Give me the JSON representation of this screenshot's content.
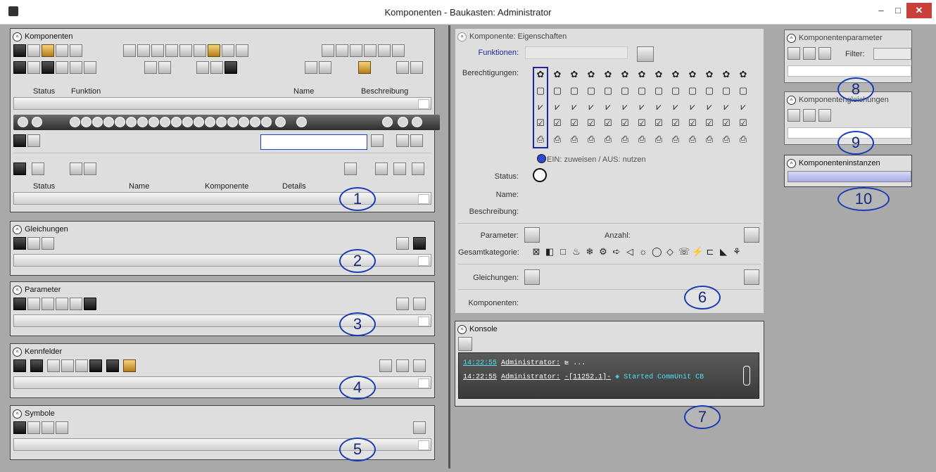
{
  "window": {
    "title": "Komponenten - Baukasten: Administrator",
    "minimize_label": "–",
    "maximize_label": "□",
    "close_label": "✕"
  },
  "left": {
    "komponenten": {
      "title": "Komponenten",
      "columns1": {
        "status": "Status",
        "funktion": "Funktion",
        "name": "Name",
        "beschreibung": "Beschreibung"
      },
      "columns2": {
        "status": "Status",
        "name": "Name",
        "komponente": "Komponente",
        "details": "Details"
      },
      "search_value": ""
    },
    "gleichungen": {
      "title": "Gleichungen"
    },
    "parameter": {
      "title": "Parameter"
    },
    "kennfelder": {
      "title": "Kennfelder"
    },
    "symbole": {
      "title": "Symbole"
    }
  },
  "properties": {
    "title": "Komponente: Eigenschaften",
    "funktionen_label": "Funktionen:",
    "funktionen_value": "",
    "berechtigungen_label": "Berechtigungen:",
    "legend": "EIN: zuweisen / AUS: nutzen",
    "status_label": "Status:",
    "name_label": "Name:",
    "beschreibung_label": "Beschreibung:",
    "parameter_label": "Parameter:",
    "anzahl_label": "Anzahl:",
    "gesamtkategorie_label": "Gesamtkategorie:",
    "gleichungen_label": "Gleichungen:",
    "komponenten_label": "Komponenten:"
  },
  "console": {
    "title": "Konsole",
    "lines": [
      {
        "time": "14:22:55",
        "user": "Administrator:",
        "text": "⊵ ...",
        "message": ""
      },
      {
        "time": "14:22:55",
        "user": "Administrator:",
        "text": "-[11252.1]-",
        "message": "Started CommUnit CB"
      }
    ]
  },
  "right": {
    "komponentenparameter": {
      "title": "Komponentenparameter",
      "filter_label": "Filter:",
      "filter_value": ""
    },
    "komponentengleichungen": {
      "title": "Komponentengleichungen"
    },
    "komponenteninstanzen": {
      "title": "Komponenteninstanzen"
    }
  },
  "annotations": [
    "1",
    "2",
    "3",
    "4",
    "5",
    "6",
    "7",
    "8",
    "9",
    "10"
  ],
  "colors": {
    "accent_blue": "#1a3bb3",
    "close_red": "#c7403a",
    "background": "#a9a9a9",
    "panel": "#dedede"
  }
}
